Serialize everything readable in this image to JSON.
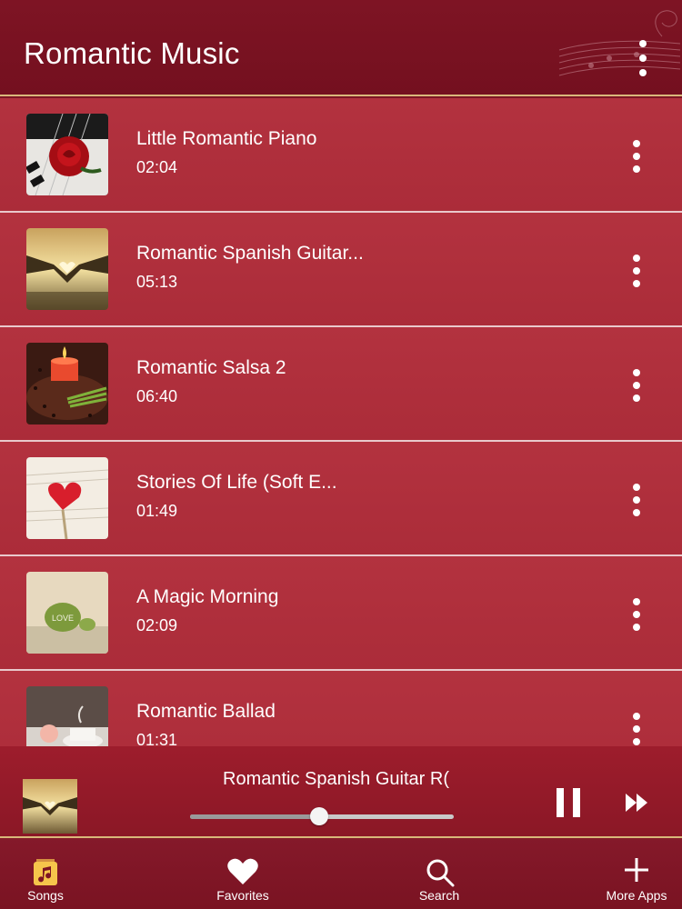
{
  "header": {
    "title": "Romantic Music"
  },
  "songs": [
    {
      "title": "Little Romantic Piano",
      "duration": "02:04",
      "art": "rose-on-piano"
    },
    {
      "title": "Romantic Spanish Guitar...",
      "duration": "05:13",
      "art": "heart-hands-sunset"
    },
    {
      "title": "Romantic Salsa 2",
      "duration": "06:40",
      "art": "candle"
    },
    {
      "title": "Stories Of Life (Soft E...",
      "duration": "01:49",
      "art": "heart-on-book"
    },
    {
      "title": "A Magic Morning",
      "duration": "02:09",
      "art": "love-stone"
    },
    {
      "title": "Romantic Ballad",
      "duration": "01:31",
      "art": "teacup"
    }
  ],
  "player": {
    "now_playing": "Romantic Spanish Guitar R(",
    "progress": 0.49,
    "art": "heart-hands-sunset"
  },
  "tabs": [
    {
      "label": "Songs",
      "icon": "music-note-icon",
      "active": true
    },
    {
      "label": "Favorites",
      "icon": "heart-icon"
    },
    {
      "label": "Search",
      "icon": "search-icon"
    },
    {
      "label": "More Apps",
      "icon": "plus-icon"
    }
  ],
  "colors": {
    "header": "#7e1424",
    "row": "#b3323f",
    "accent": "#f6c54b",
    "divider": "#d9b77a"
  }
}
